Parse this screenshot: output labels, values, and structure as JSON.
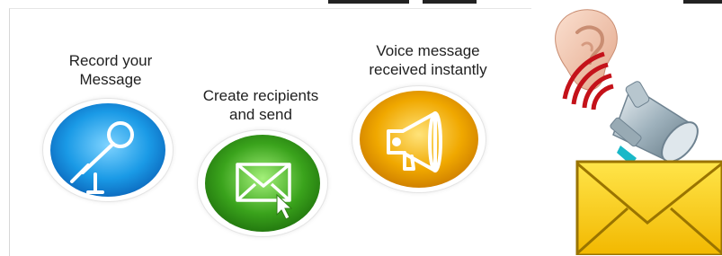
{
  "steps": [
    {
      "label_line1": "Record your",
      "label_line2": "Message",
      "icon": "microphone-icon",
      "color": "#1a9ae6"
    },
    {
      "label_line1": "Create recipients",
      "label_line2": "and send",
      "icon": "envelope-icon",
      "color": "#3aa31c"
    },
    {
      "label_line1": "Voice message",
      "label_line2": "received instantly",
      "icon": "megaphone-icon",
      "color": "#f0a800"
    }
  ],
  "art": {
    "ear_icon": "ear-icon",
    "sound_waves_icon": "sound-waves-icon",
    "megaphone_icon": "silver-megaphone-icon",
    "envelope_icon": "yellow-envelope-icon",
    "envelope_color": "#f7c600"
  }
}
